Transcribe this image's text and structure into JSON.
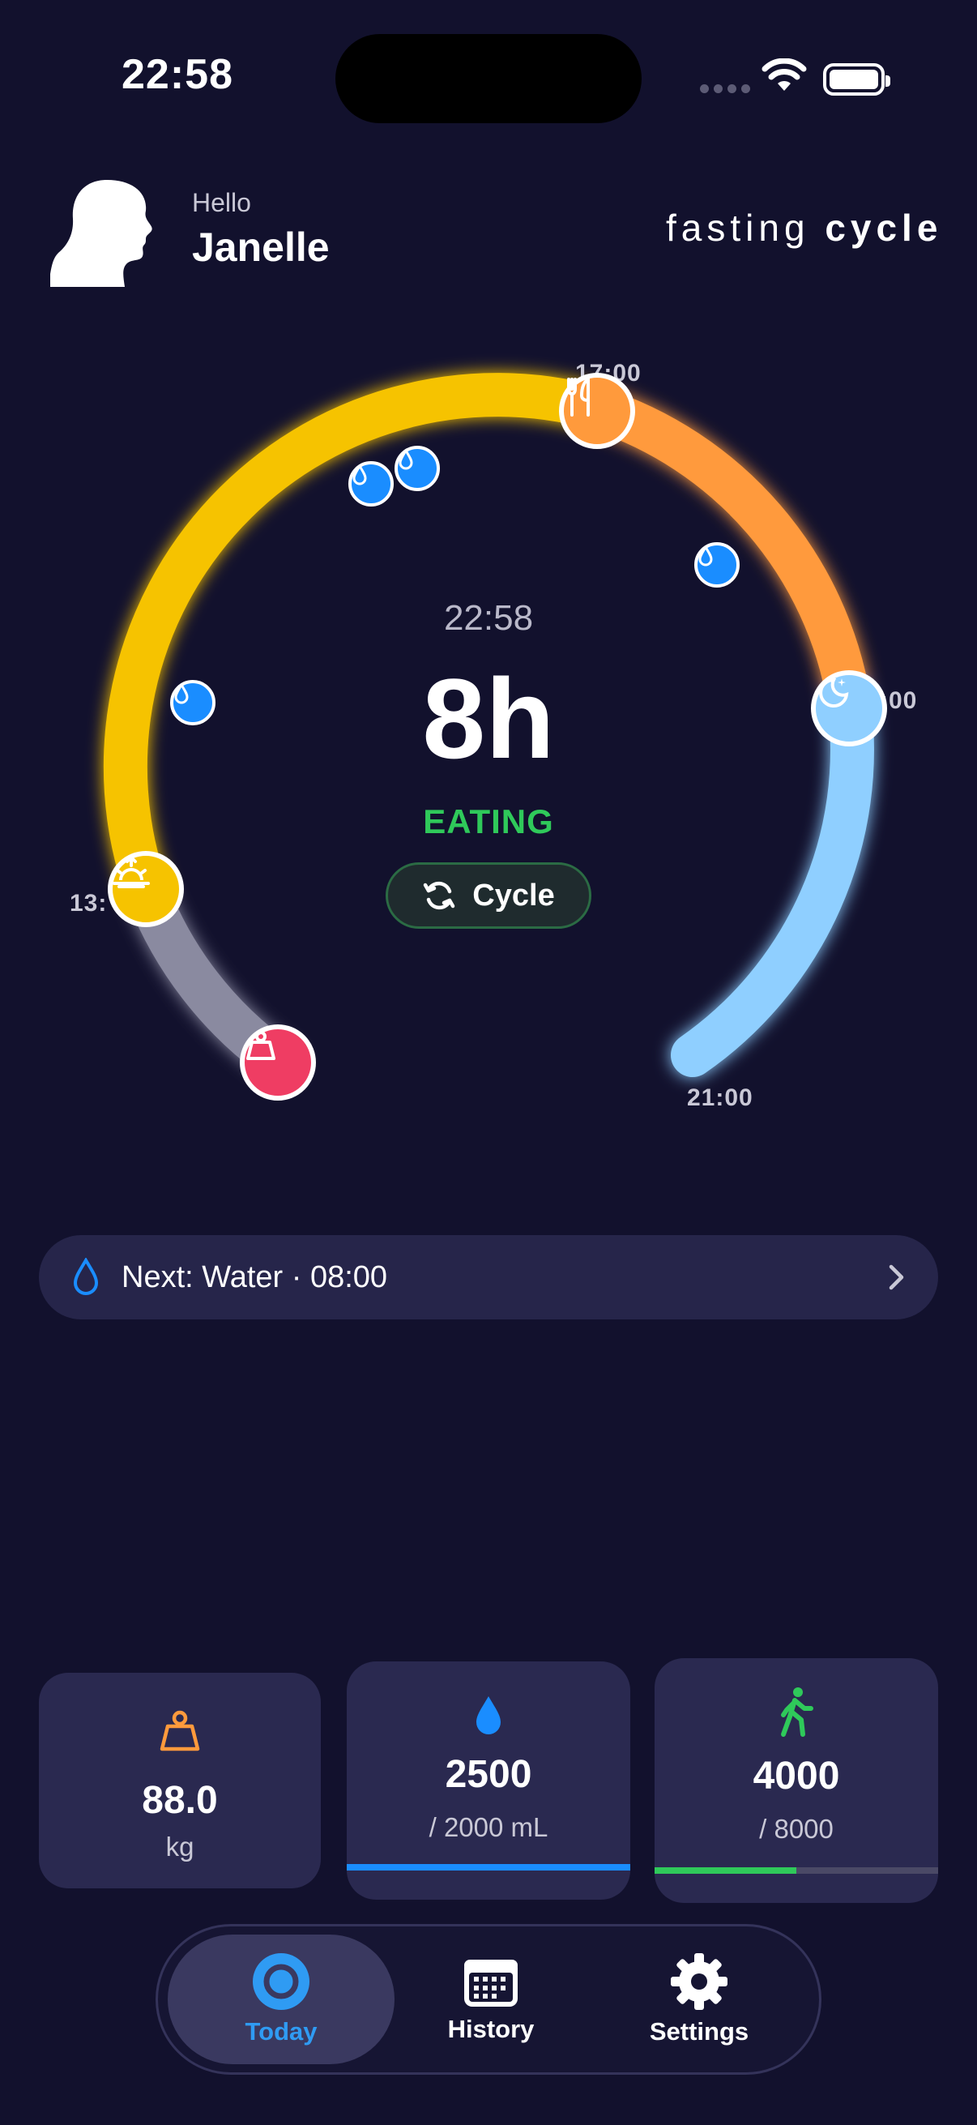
{
  "status_bar": {
    "time": "22:58"
  },
  "header": {
    "greeting": "Hello",
    "name": "Janelle",
    "logo_prefix": "fasting ",
    "logo_suffix": "cycle"
  },
  "dial": {
    "current_time": "22:58",
    "hours": "8h",
    "phase": "EATING",
    "cycle_label": "Cycle",
    "labels": {
      "eat_start": "17:00",
      "sleep": ":00",
      "wake": "13:",
      "end": "21:00"
    },
    "colors": {
      "eating": "#f6c300",
      "orange": "#ff9a3c",
      "sleep": "#8fcfff",
      "past": "#8a8aa0",
      "weight": "#ef3d63"
    }
  },
  "next": {
    "label": "Next: Water · 08:00",
    "icons": [
      "water-drop-icon",
      "chevron-right-icon"
    ]
  },
  "stats": {
    "weight": {
      "value": "88.0",
      "unit": "kg",
      "icon": "weight-icon"
    },
    "water": {
      "value": "2500",
      "unit": "/ 2000 mL",
      "progress": 1.0,
      "color": "#1a8dff",
      "icon": "water-drop-icon"
    },
    "steps": {
      "value": "4000",
      "unit": "/ 8000",
      "progress": 0.5,
      "color": "#2fc95a",
      "icon": "walking-icon"
    }
  },
  "tabs": [
    {
      "label": "Today",
      "icon": "today-icon",
      "active": true
    },
    {
      "label": "History",
      "icon": "calendar-icon",
      "active": false
    },
    {
      "label": "Settings",
      "icon": "gear-icon",
      "active": false
    }
  ]
}
